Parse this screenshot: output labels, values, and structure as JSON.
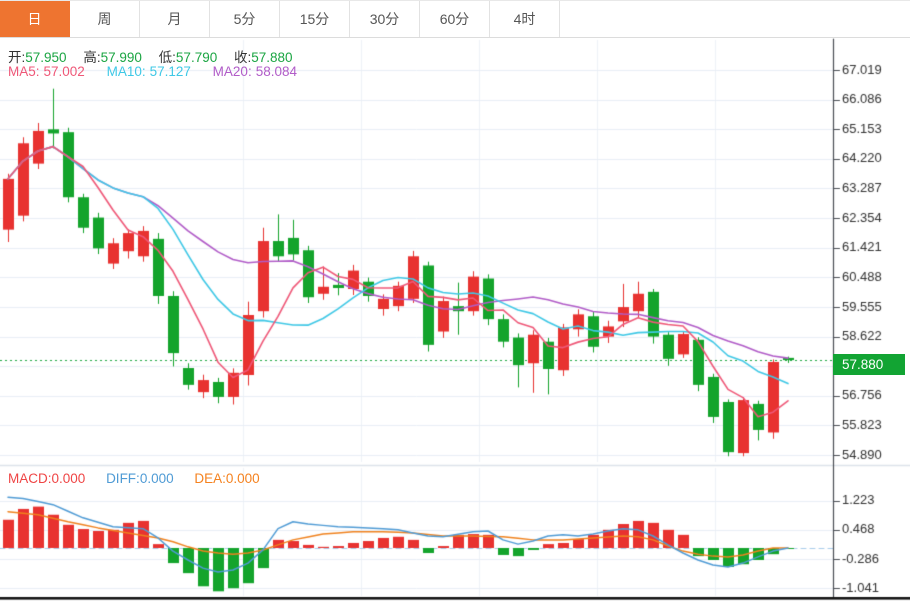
{
  "header": {
    "tabs": [
      {
        "label": "日",
        "active": true
      },
      {
        "label": "周",
        "active": false
      },
      {
        "label": "月",
        "active": false
      },
      {
        "label": "5分",
        "active": false
      },
      {
        "label": "15分",
        "active": false
      },
      {
        "label": "30分",
        "active": false
      },
      {
        "label": "60分",
        "active": false
      },
      {
        "label": "4时",
        "active": false
      }
    ]
  },
  "main_legend": {
    "ohlc": [
      {
        "label": "开:",
        "value": "57.950"
      },
      {
        "label": "高:",
        "value": "57.990"
      },
      {
        "label": "低:",
        "value": "57.790"
      },
      {
        "label": "收:",
        "value": "57.880"
      }
    ],
    "ma": [
      {
        "label": "MA5:",
        "value": "57.002"
      },
      {
        "label": "MA10:",
        "value": "57.127"
      },
      {
        "label": "MA20:",
        "value": "58.084"
      }
    ]
  },
  "macd_legend": [
    {
      "label": "MACD:",
      "value": "0.000"
    },
    {
      "label": "DIFF:",
      "value": "0.000"
    },
    {
      "label": "DEA:",
      "value": "0.000"
    }
  ],
  "colors": {
    "up_red": "#e83230",
    "down_green": "#14a42c",
    "tab_active_orange": "#ee7430",
    "price_tag_green": "#12a433",
    "price_dotted_green": "#1fa843",
    "ohlc_value_green": "#1ba543",
    "ma5_pink": "#ef5878",
    "ma10_cyan": "#3fc8e6",
    "ma20_purple": "#b15cc8",
    "diff_blue": "#4f9bd5",
    "dea_orange": "#f0821e",
    "grid": "#e9eef6",
    "axis_line": "#4a4e54",
    "axis_text": "#333333",
    "zero_dash_blue": "#a9cdeb",
    "bottom_bar_black": "#141414"
  },
  "chart_data": {
    "type": "candlestick",
    "panels": [
      "price+MA",
      "MACD"
    ],
    "price_axis": {
      "visible_ticks": [
        "67.019",
        "66.086",
        "65.153",
        "64.220",
        "63.287",
        "62.354",
        "61.421",
        "60.488",
        "59.555",
        "58.622",
        "56.756",
        "55.823",
        "54.890"
      ],
      "tick_values": [
        67.019,
        66.086,
        65.153,
        64.22,
        63.287,
        62.354,
        61.421,
        60.488,
        59.555,
        58.622,
        56.756,
        55.823,
        54.89
      ],
      "top_value": 67.019,
      "bottom_value": 54.89,
      "tick_step": 0.933,
      "current_price": 57.88,
      "current_price_label": "57.880"
    },
    "ohlc_display": {
      "open": 57.95,
      "high": 57.99,
      "low": 57.79,
      "close": 57.88
    },
    "ma_display": {
      "ma5": 57.002,
      "ma10": 57.127,
      "ma20": 58.084,
      "periods": [
        5,
        10,
        20
      ]
    },
    "candles": [
      {
        "o": 61.99,
        "h": 63.75,
        "l": 61.6,
        "c": 63.59
      },
      {
        "o": 62.43,
        "h": 64.9,
        "l": 62.25,
        "c": 64.71
      },
      {
        "o": 64.07,
        "h": 65.35,
        "l": 63.9,
        "c": 65.1
      },
      {
        "o": 65.15,
        "h": 66.43,
        "l": 64.55,
        "c": 65.02
      },
      {
        "o": 65.06,
        "h": 65.2,
        "l": 62.85,
        "c": 63.01
      },
      {
        "o": 63.01,
        "h": 63.12,
        "l": 61.88,
        "c": 62.05
      },
      {
        "o": 62.37,
        "h": 62.52,
        "l": 61.22,
        "c": 61.4
      },
      {
        "o": 60.92,
        "h": 61.72,
        "l": 60.75,
        "c": 61.56
      },
      {
        "o": 61.31,
        "h": 62.0,
        "l": 61.08,
        "c": 61.88
      },
      {
        "o": 61.15,
        "h": 62.1,
        "l": 60.98,
        "c": 61.95
      },
      {
        "o": 61.7,
        "h": 61.88,
        "l": 59.65,
        "c": 59.9
      },
      {
        "o": 59.9,
        "h": 60.05,
        "l": 57.68,
        "c": 58.1
      },
      {
        "o": 57.63,
        "h": 57.78,
        "l": 56.95,
        "c": 57.1
      },
      {
        "o": 56.87,
        "h": 57.42,
        "l": 56.68,
        "c": 57.25
      },
      {
        "o": 57.19,
        "h": 57.32,
        "l": 56.52,
        "c": 56.72
      },
      {
        "o": 56.72,
        "h": 57.62,
        "l": 56.48,
        "c": 57.48
      },
      {
        "o": 57.41,
        "h": 59.72,
        "l": 57.08,
        "c": 59.3
      },
      {
        "o": 59.42,
        "h": 62.05,
        "l": 59.22,
        "c": 61.63
      },
      {
        "o": 61.63,
        "h": 62.47,
        "l": 60.98,
        "c": 61.15
      },
      {
        "o": 61.73,
        "h": 62.3,
        "l": 61.02,
        "c": 61.21
      },
      {
        "o": 61.34,
        "h": 61.48,
        "l": 59.68,
        "c": 59.86
      },
      {
        "o": 59.97,
        "h": 60.83,
        "l": 59.78,
        "c": 60.19
      },
      {
        "o": 60.25,
        "h": 60.62,
        "l": 59.92,
        "c": 60.15
      },
      {
        "o": 60.12,
        "h": 60.88,
        "l": 59.93,
        "c": 60.7
      },
      {
        "o": 60.35,
        "h": 60.48,
        "l": 59.72,
        "c": 59.9
      },
      {
        "o": 59.49,
        "h": 59.95,
        "l": 59.28,
        "c": 59.81
      },
      {
        "o": 59.58,
        "h": 60.35,
        "l": 59.42,
        "c": 60.22
      },
      {
        "o": 59.81,
        "h": 61.32,
        "l": 59.68,
        "c": 61.15
      },
      {
        "o": 60.86,
        "h": 60.98,
        "l": 58.15,
        "c": 58.36
      },
      {
        "o": 58.78,
        "h": 59.88,
        "l": 58.58,
        "c": 59.74
      },
      {
        "o": 59.58,
        "h": 60.32,
        "l": 58.68,
        "c": 59.42
      },
      {
        "o": 59.42,
        "h": 60.68,
        "l": 59.28,
        "c": 60.51
      },
      {
        "o": 60.45,
        "h": 60.58,
        "l": 58.98,
        "c": 59.17
      },
      {
        "o": 59.17,
        "h": 59.32,
        "l": 58.28,
        "c": 58.46
      },
      {
        "o": 58.59,
        "h": 58.72,
        "l": 57.02,
        "c": 57.72
      },
      {
        "o": 57.78,
        "h": 58.82,
        "l": 56.85,
        "c": 58.68
      },
      {
        "o": 58.46,
        "h": 58.58,
        "l": 56.8,
        "c": 57.6
      },
      {
        "o": 57.56,
        "h": 59.02,
        "l": 57.38,
        "c": 58.91
      },
      {
        "o": 58.85,
        "h": 59.48,
        "l": 58.62,
        "c": 59.32
      },
      {
        "o": 59.26,
        "h": 59.42,
        "l": 58.12,
        "c": 58.3
      },
      {
        "o": 58.62,
        "h": 59.12,
        "l": 58.42,
        "c": 58.94
      },
      {
        "o": 59.1,
        "h": 60.28,
        "l": 58.92,
        "c": 59.55
      },
      {
        "o": 59.42,
        "h": 60.35,
        "l": 59.22,
        "c": 59.97
      },
      {
        "o": 60.03,
        "h": 60.12,
        "l": 58.4,
        "c": 58.62
      },
      {
        "o": 58.68,
        "h": 58.76,
        "l": 57.7,
        "c": 57.92
      },
      {
        "o": 58.06,
        "h": 58.78,
        "l": 57.95,
        "c": 58.7
      },
      {
        "o": 58.52,
        "h": 58.6,
        "l": 56.9,
        "c": 57.1
      },
      {
        "o": 57.35,
        "h": 57.45,
        "l": 55.9,
        "c": 56.09
      },
      {
        "o": 56.56,
        "h": 56.64,
        "l": 54.85,
        "c": 54.98
      },
      {
        "o": 54.95,
        "h": 56.7,
        "l": 54.85,
        "c": 56.62
      },
      {
        "o": 56.5,
        "h": 56.6,
        "l": 55.35,
        "c": 55.68
      },
      {
        "o": 55.6,
        "h": 57.9,
        "l": 55.4,
        "c": 57.82
      },
      {
        "o": 57.95,
        "h": 57.99,
        "l": 57.79,
        "c": 57.88
      }
    ],
    "macd": {
      "axis_ticks": [
        "1.223",
        "0.468",
        "-0.286",
        "-1.041"
      ],
      "axis_tick_values": [
        1.223,
        0.468,
        -0.286,
        -1.041
      ],
      "macd": 0.0,
      "diff": 0.0,
      "dea": 0.0,
      "histogram": [
        0.73,
        1.01,
        1.07,
        0.86,
        0.6,
        0.49,
        0.44,
        0.47,
        0.65,
        0.7,
        0.1,
        -0.39,
        -0.65,
        -0.99,
        -1.12,
        -1.04,
        -0.91,
        -0.52,
        0.21,
        0.18,
        0.08,
        0.03,
        0.05,
        0.13,
        0.18,
        0.26,
        0.29,
        0.21,
        -0.13,
        0.05,
        0.34,
        0.36,
        0.34,
        -0.18,
        -0.21,
        -0.05,
        0.1,
        0.13,
        0.23,
        0.34,
        0.47,
        0.62,
        0.7,
        0.65,
        0.47,
        0.34,
        -0.21,
        -0.31,
        -0.49,
        -0.42,
        -0.31,
        -0.16,
        -0.02
      ],
      "diff_points": [
        [
          1,
          1.31
        ],
        [
          2,
          1.28
        ],
        [
          4,
          1.12
        ],
        [
          6,
          0.78
        ],
        [
          8,
          0.55
        ],
        [
          10,
          0.5
        ],
        [
          11,
          0.26
        ],
        [
          12,
          -0.08
        ],
        [
          13,
          -0.31
        ],
        [
          14,
          -0.52
        ],
        [
          15,
          -0.62
        ],
        [
          16,
          -0.57
        ],
        [
          17,
          -0.39
        ],
        [
          18,
          -0.05
        ],
        [
          19,
          0.5
        ],
        [
          20,
          0.68
        ],
        [
          21,
          0.62
        ],
        [
          23,
          0.55
        ],
        [
          25,
          0.52
        ],
        [
          27,
          0.47
        ],
        [
          29,
          0.31
        ],
        [
          30,
          0.29
        ],
        [
          32,
          0.42
        ],
        [
          33,
          0.44
        ],
        [
          34,
          0.21
        ],
        [
          35,
          0.1
        ],
        [
          36,
          0.18
        ],
        [
          37,
          0.31
        ],
        [
          38,
          0.34
        ],
        [
          39,
          0.31
        ],
        [
          40,
          0.36
        ],
        [
          41,
          0.44
        ],
        [
          42,
          0.5
        ],
        [
          43,
          0.47
        ],
        [
          44,
          0.31
        ],
        [
          45,
          0.08
        ],
        [
          46,
          -0.13
        ],
        [
          47,
          -0.31
        ],
        [
          48,
          -0.44
        ],
        [
          49,
          -0.49
        ],
        [
          50,
          -0.39
        ],
        [
          51,
          -0.23
        ],
        [
          52,
          -0.08
        ],
        [
          53,
          0.0
        ]
      ],
      "dea_points": [
        [
          1,
          0.94
        ],
        [
          3,
          0.86
        ],
        [
          5,
          0.68
        ],
        [
          7,
          0.52
        ],
        [
          9,
          0.39
        ],
        [
          11,
          0.26
        ],
        [
          12,
          0.16
        ],
        [
          13,
          0.03
        ],
        [
          14,
          -0.08
        ],
        [
          15,
          -0.13
        ],
        [
          16,
          -0.16
        ],
        [
          17,
          -0.13
        ],
        [
          18,
          -0.05
        ],
        [
          19,
          0.08
        ],
        [
          20,
          0.21
        ],
        [
          22,
          0.36
        ],
        [
          24,
          0.42
        ],
        [
          26,
          0.42
        ],
        [
          28,
          0.39
        ],
        [
          30,
          0.31
        ],
        [
          32,
          0.31
        ],
        [
          34,
          0.29
        ],
        [
          36,
          0.21
        ],
        [
          38,
          0.21
        ],
        [
          40,
          0.26
        ],
        [
          42,
          0.31
        ],
        [
          43,
          0.29
        ],
        [
          44,
          0.21
        ],
        [
          45,
          0.05
        ],
        [
          46,
          -0.08
        ],
        [
          47,
          -0.16
        ],
        [
          48,
          -0.21
        ],
        [
          49,
          -0.23
        ],
        [
          50,
          -0.18
        ],
        [
          51,
          -0.08
        ],
        [
          52,
          0.0
        ],
        [
          53,
          0.0
        ]
      ]
    }
  }
}
